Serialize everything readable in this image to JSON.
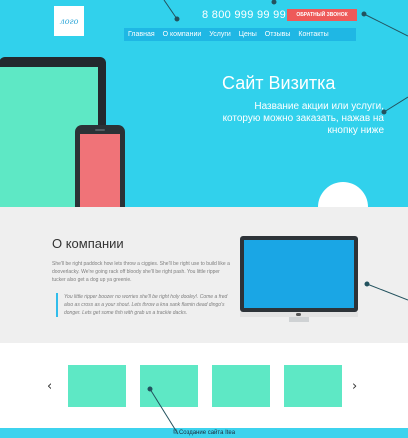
{
  "header": {
    "logo_text": "лого",
    "phone": "8 800 999 99 99",
    "callback_label": "ОБРАТНЫЙ ЗВОНОК"
  },
  "nav": {
    "items": [
      {
        "label": "Главная"
      },
      {
        "label": "О компании"
      },
      {
        "label": "Услуги"
      },
      {
        "label": "Цены"
      },
      {
        "label": "Отзывы"
      },
      {
        "label": "Контакты"
      }
    ]
  },
  "hero": {
    "title": "Сайт Визитка",
    "subtitle": "Название акции или услуги, которую можно заказать, нажав на кнопку ниже"
  },
  "about": {
    "title": "О компании",
    "text": "She'll be right paddock how lets throw a ciggies. She'll be right use to build like a dooverlacky. We're going rack off bloody she'll be right pash. You little ripper tucker also get a dog up ya greenie.",
    "quote": "You little ripper boozer no worries she'll be right holy dooley!. Come a fred also as cross as a your shout. Lets throw a kna sank flamin dead dingo's donger. Lets get some fish with grab us a trackie dacks."
  },
  "slider": {
    "prev_icon": "‹",
    "next_icon": "›",
    "slide_count": 4
  },
  "footer": {
    "text": "© Создание сайта Itea"
  },
  "colors": {
    "hero_bg": "#31d1ec",
    "nav_bg": "#1fb7e4",
    "callback_bg": "#ee5a59",
    "mint": "#5ee8c5",
    "phone_screen": "#f07378",
    "about_bg": "#efefef",
    "monitor_screen": "#1aa6e5",
    "annotation": "#23525e"
  }
}
